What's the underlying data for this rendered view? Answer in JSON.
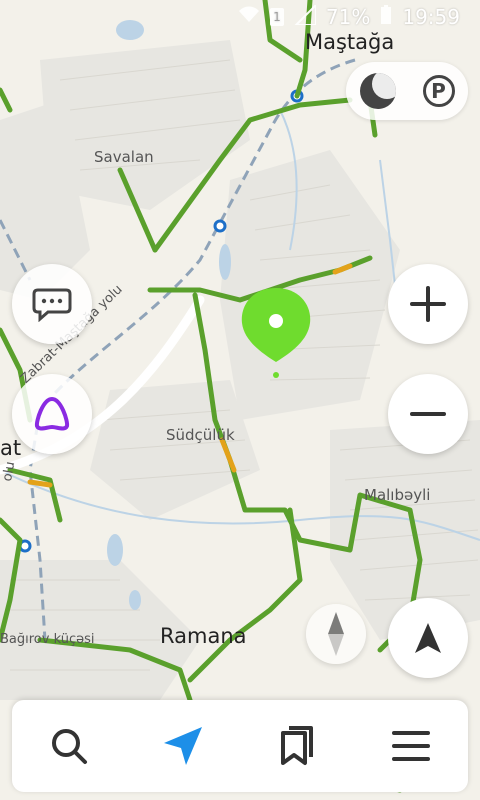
{
  "status_bar": {
    "battery": "71%",
    "time": "19:59",
    "sim": "1",
    "signal_icon": "signal-icon",
    "wifi_icon": "wifi-icon"
  },
  "map": {
    "labels": {
      "mastaga": "Maştağa",
      "savalan": "Savalan",
      "zabrat_road": "Zabrat-Maştağa yolu",
      "sudculuk": "Südçülük",
      "malibeyli": "Malıbəyli",
      "ramana": "Ramana",
      "bagirov_street": "Bağırov küçəsi",
      "edge_at": "at",
      "edge_olu": "olu"
    },
    "colors": {
      "traffic_green": "#5aa02c",
      "traffic_yellow": "#e3a21a",
      "rail": "#8fa3b8",
      "pin": "#6fdc2e",
      "accent_blue": "#1d8fe8",
      "alice_purple": "#8a2be2"
    }
  },
  "controls": {
    "layers": {
      "traffic_icon": "traffic-layer-icon",
      "parking_label": "P"
    },
    "chat_icon": "chat-bubble-icon",
    "alice_icon": "alice-assistant-icon",
    "zoom_in_icon": "plus-icon",
    "zoom_out_icon": "minus-icon",
    "compass_icon": "compass-icon",
    "locate_icon": "navigation-arrow-icon"
  },
  "bottom_bar": {
    "items": [
      {
        "icon": "search-icon"
      },
      {
        "icon": "navigation-icon",
        "active": true
      },
      {
        "icon": "bookmarks-icon"
      },
      {
        "icon": "menu-icon"
      }
    ]
  }
}
